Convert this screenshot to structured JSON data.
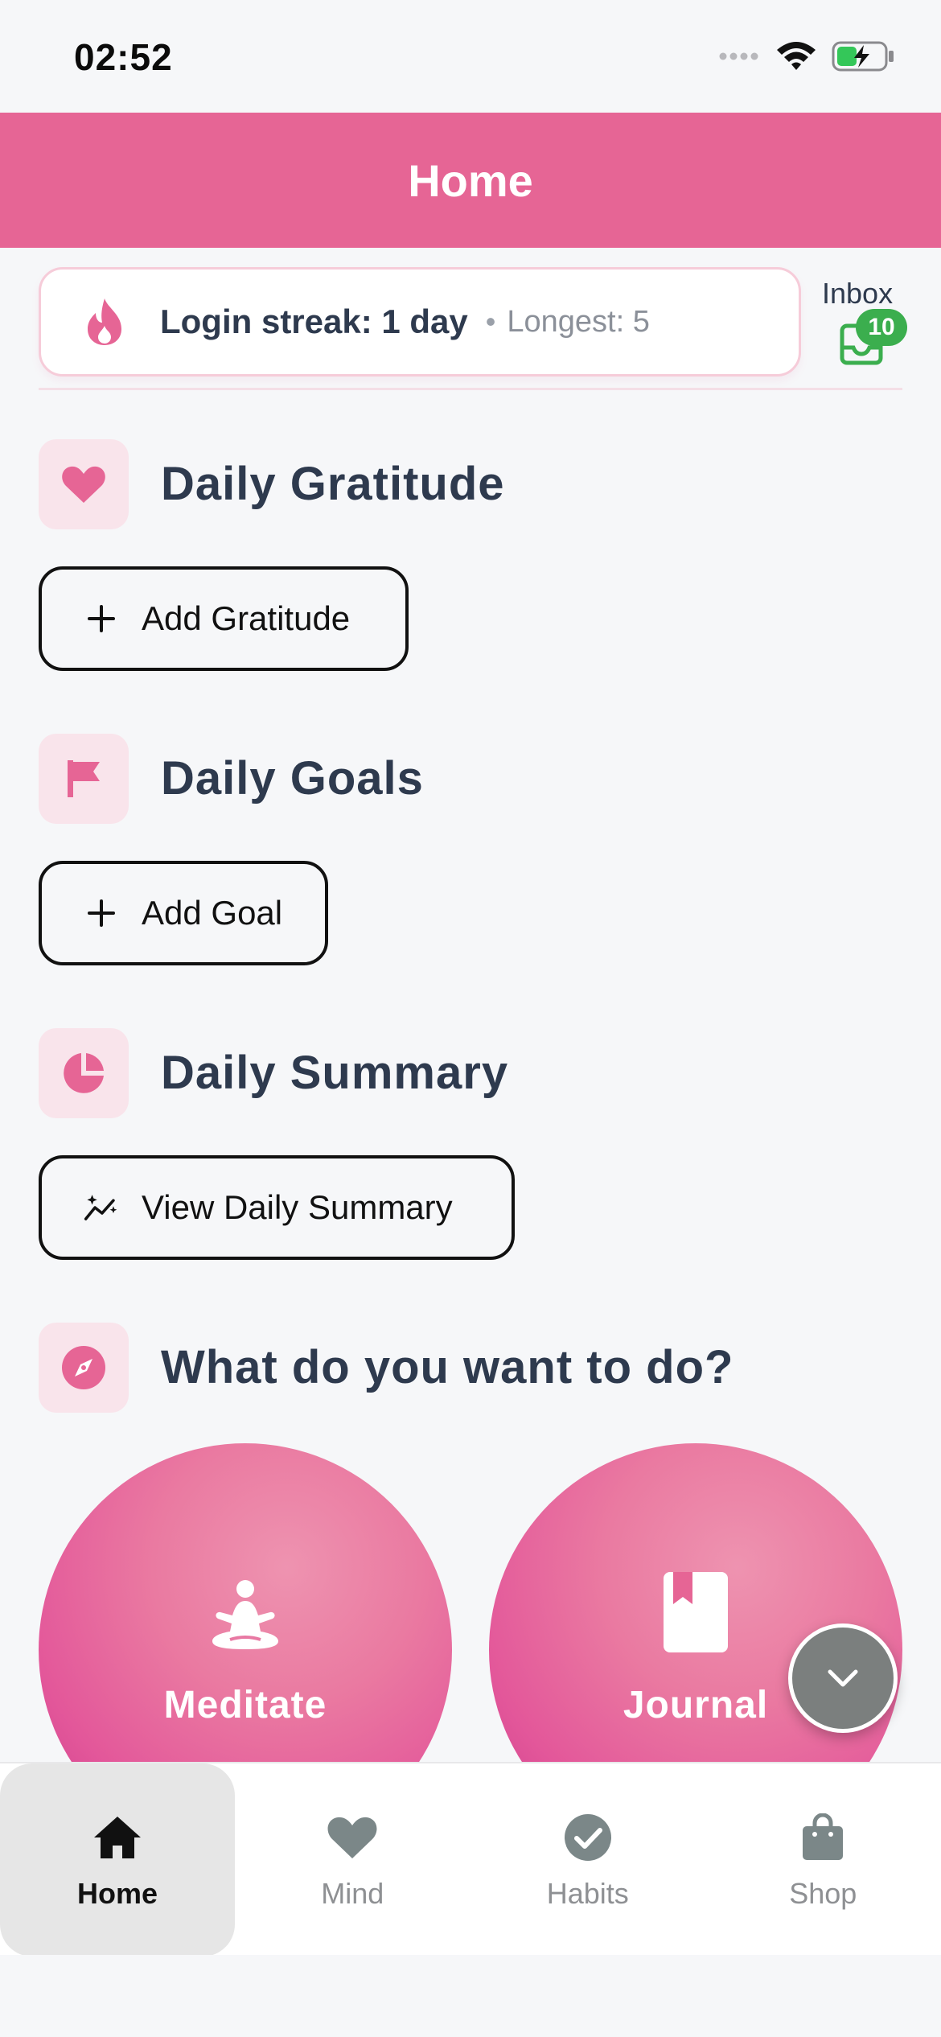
{
  "status_bar": {
    "time": "02:52"
  },
  "header": {
    "title": "Home"
  },
  "streak": {
    "text": "Login streak: 1 day",
    "separator": "•",
    "longest": "Longest: 5"
  },
  "inbox": {
    "label": "Inbox",
    "badge": "10"
  },
  "sections": {
    "gratitude": {
      "title": "Daily Gratitude",
      "button": "Add Gratitude"
    },
    "goals": {
      "title": "Daily Goals",
      "button": "Add Goal"
    },
    "summary": {
      "title": "Daily Summary",
      "button": "View Daily Summary"
    },
    "actions": {
      "title": "What do you want to do?"
    }
  },
  "actions": {
    "meditate": "Meditate",
    "journal": "Journal"
  },
  "nav": {
    "home": "Home",
    "mind": "Mind",
    "habits": "Habits",
    "shop": "Shop"
  },
  "colors": {
    "accent": "#E66595",
    "icon_bg": "#F9E4EB",
    "badge": "#3BAE4E",
    "text": "#2E3A4E"
  },
  "icons": {
    "streak": "flame-icon",
    "inbox": "inbox-tray-icon",
    "gratitude": "heart-icon",
    "goals": "flag-icon",
    "summary": "pie-chart-icon",
    "actions": "compass-icon",
    "meditate": "meditation-icon",
    "journal": "bookmark-book-icon",
    "fab": "chevron-down-icon"
  }
}
